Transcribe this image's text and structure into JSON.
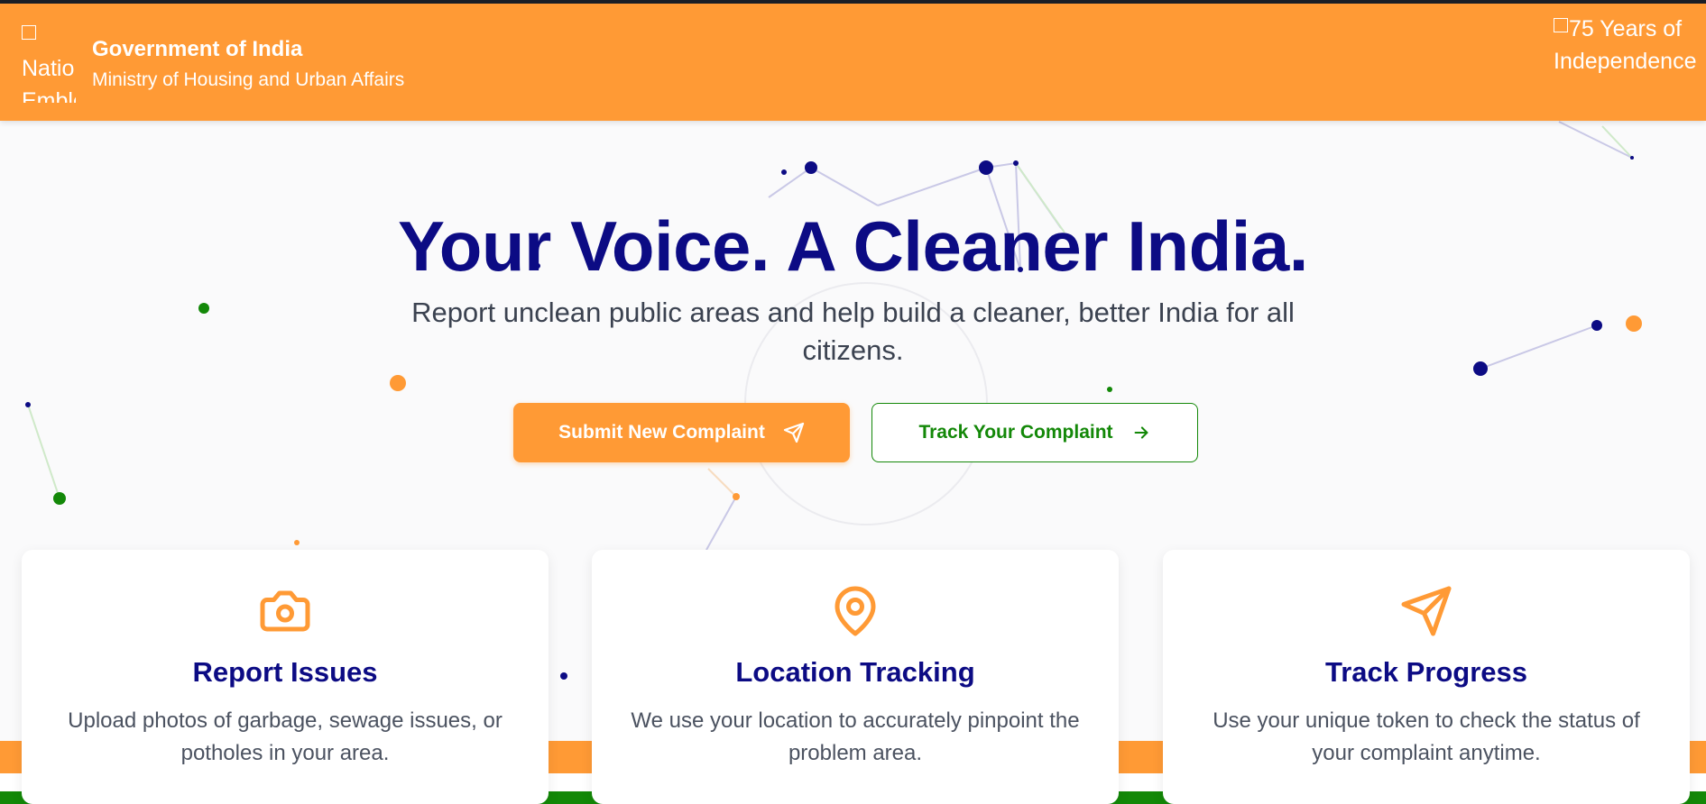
{
  "header": {
    "emblem_alt": "National Emblem",
    "title": "Government of India",
    "subtitle": "Ministry of Housing and Urban Affairs",
    "badge_alt": "75 Years of Independence"
  },
  "hero": {
    "title": "Your Voice. A Cleaner India.",
    "subtitle": "Report unclean public areas and help build a cleaner, better India for all citizens.",
    "submit_label": "Submit New Complaint",
    "track_label": "Track Your Complaint"
  },
  "features": [
    {
      "icon": "camera-icon",
      "title": "Report Issues",
      "text": "Upload photos of garbage, sewage issues, or potholes in your area."
    },
    {
      "icon": "map-pin-icon",
      "title": "Location Tracking",
      "text": "We use your location to accurately pinpoint the problem area."
    },
    {
      "icon": "send-icon",
      "title": "Track Progress",
      "text": "Use your unique token to check the status of your complaint anytime."
    }
  ],
  "colors": {
    "saffron": "#ff9a35",
    "navy": "#0c0b84",
    "green": "#138808"
  }
}
